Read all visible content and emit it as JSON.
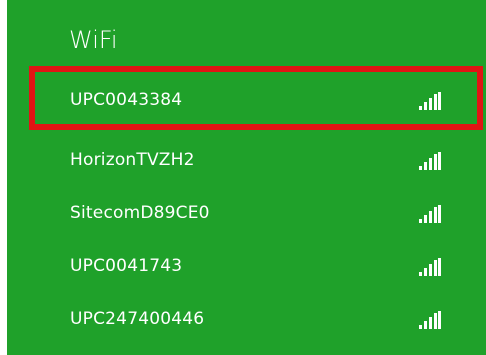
{
  "panel": {
    "title": "WiFi",
    "background_color": "#1fa12a",
    "highlight_color": "#e11414",
    "networks": [
      {
        "name": "UPC0043384",
        "signal_icon": "wifi-signal-full-icon",
        "highlighted": true
      },
      {
        "name": "HorizonTVZH2",
        "signal_icon": "wifi-signal-full-icon",
        "highlighted": false
      },
      {
        "name": "SitecomD89CE0",
        "signal_icon": "wifi-signal-full-icon",
        "highlighted": false
      },
      {
        "name": "UPC0041743",
        "signal_icon": "wifi-signal-full-icon",
        "highlighted": false
      },
      {
        "name": "UPC247400446",
        "signal_icon": "wifi-signal-full-icon",
        "highlighted": false
      }
    ]
  }
}
